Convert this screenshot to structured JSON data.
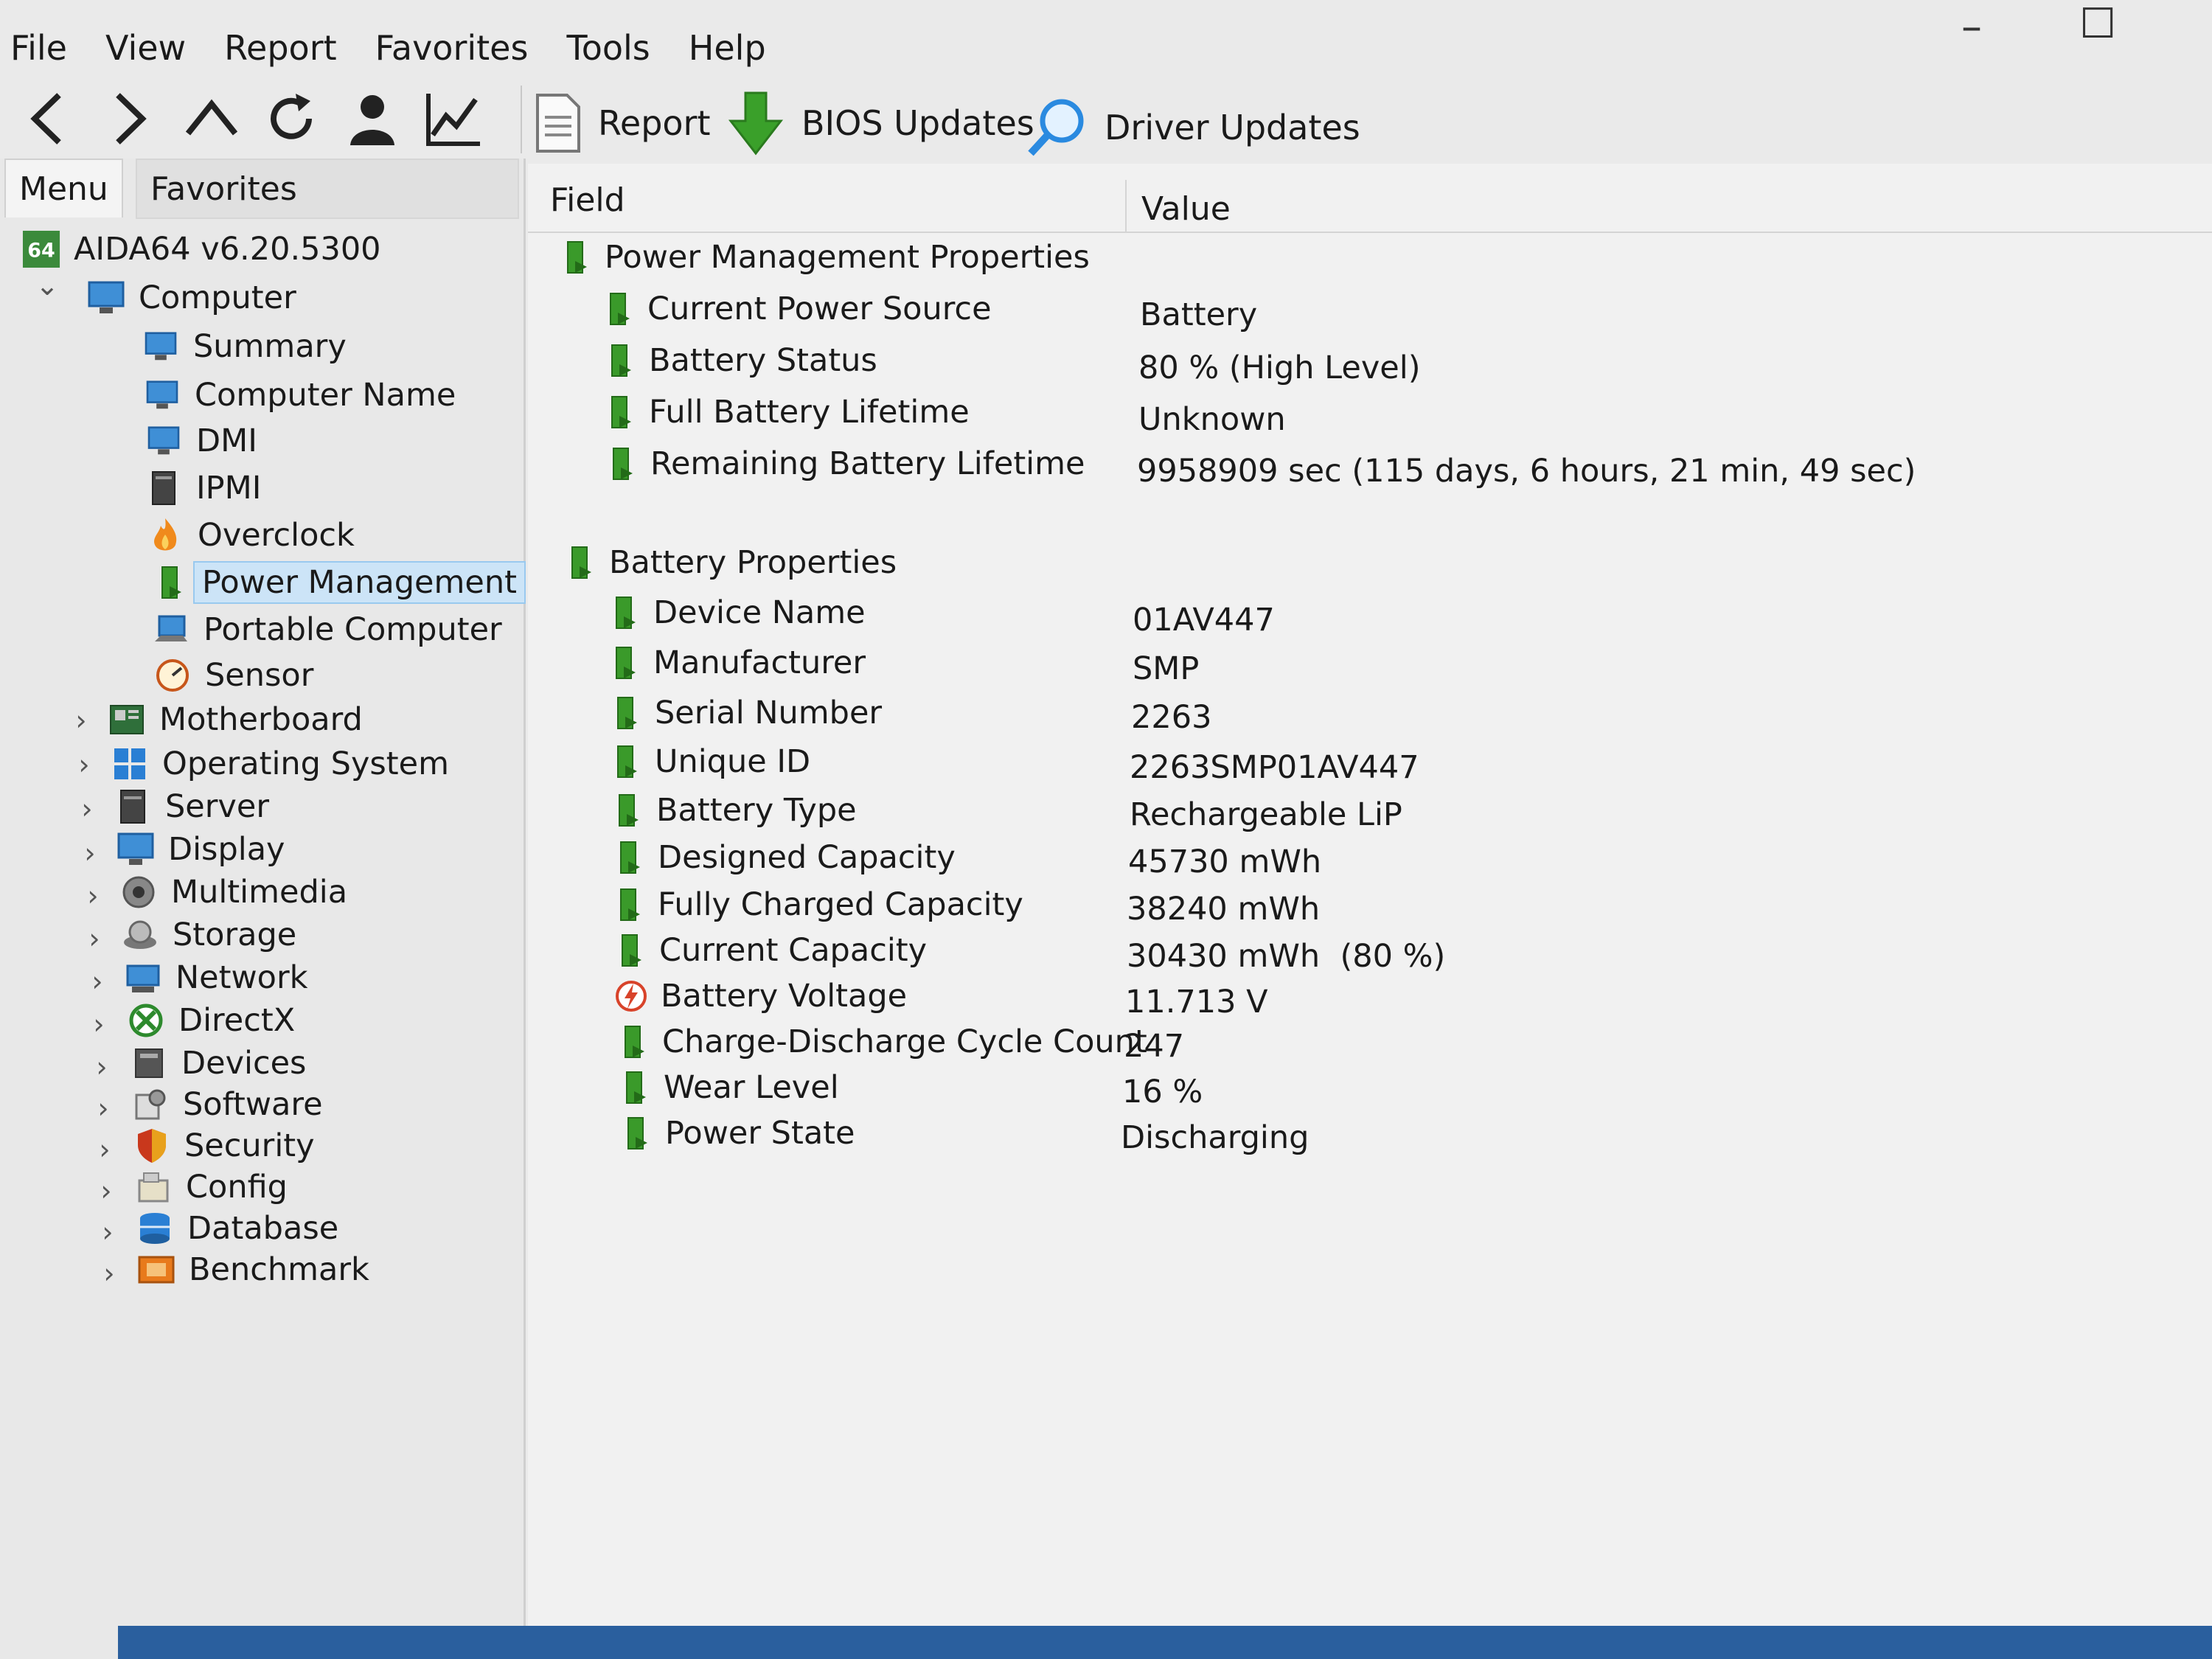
{
  "menubar": {
    "items": [
      "File",
      "View",
      "Report",
      "Favorites",
      "Tools",
      "Help"
    ]
  },
  "toolbar": {
    "report_label": "Report",
    "bios_label": "BIOS Updates",
    "driver_label": "Driver Updates"
  },
  "left_panel": {
    "tabs": {
      "menu": "Menu",
      "favorites": "Favorites"
    },
    "root_label": "AIDA64 v6.20.5300",
    "root_badge": "64",
    "computer_label": "Computer",
    "computer_children": [
      "Summary",
      "Computer Name",
      "DMI",
      "IPMI",
      "Overclock",
      "Power Management",
      "Portable Computer",
      "Sensor"
    ],
    "selected": "Power Management",
    "categories": [
      "Motherboard",
      "Operating System",
      "Server",
      "Display",
      "Multimedia",
      "Storage",
      "Network",
      "DirectX",
      "Devices",
      "Software",
      "Security",
      "Config",
      "Database",
      "Benchmark"
    ]
  },
  "grid": {
    "header_field": "Field",
    "header_value": "Value",
    "groups": [
      {
        "title": "Power Management Properties",
        "rows": [
          {
            "field": "Current Power Source",
            "value": "Battery"
          },
          {
            "field": "Battery Status",
            "value": "80 % (High Level)"
          },
          {
            "field": "Full Battery Lifetime",
            "value": "Unknown"
          },
          {
            "field": "Remaining Battery Lifetime",
            "value": "9958909 sec (115 days, 6 hours, 21 min, 49 sec)"
          }
        ]
      },
      {
        "title": "Battery Properties",
        "rows": [
          {
            "field": "Device Name",
            "value": "01AV447"
          },
          {
            "field": "Manufacturer",
            "value": "SMP"
          },
          {
            "field": "Serial Number",
            "value": "2263"
          },
          {
            "field": "Unique ID",
            "value": "2263SMP01AV447"
          },
          {
            "field": "Battery Type",
            "value": "Rechargeable LiP"
          },
          {
            "field": "Designed Capacity",
            "value": "45730 mWh"
          },
          {
            "field": "Fully Charged Capacity",
            "value": "38240 mWh"
          },
          {
            "field": "Current Capacity",
            "value": "30430 mWh  (80 %)"
          },
          {
            "field": "Battery Voltage",
            "value": "11.713 V"
          },
          {
            "field": "Charge-Discharge Cycle Count",
            "value": "247"
          },
          {
            "field": "Wear Level",
            "value": "16 %"
          },
          {
            "field": "Power State",
            "value": "Discharging"
          }
        ]
      }
    ]
  },
  "colors": {
    "selection_bg": "#cce4f7",
    "battery_green": "#3a9a2a",
    "accent_blue": "#2a7fd4"
  }
}
